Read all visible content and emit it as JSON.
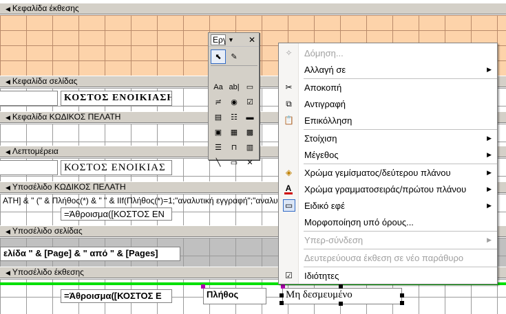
{
  "report": {
    "sections": {
      "report_header": "Κεφαλίδα έκθεσης",
      "page_header": "Κεφαλίδα σελίδας",
      "group_header": "Κεφαλίδα ΚΩΔΙΚΟΣ ΠΕΛΑΤΗ",
      "detail": "Λεπτομέρεια",
      "group_footer": "Υποσέλιδο ΚΩΔΙΚΟΣ ΠΕΛΑΤΗ",
      "page_footer": "Υποσέλιδο σελίδας",
      "report_footer": "Υποσέλιδο έκθεσης"
    },
    "controls": {
      "page_header_title": "ΚΟΣΤΟΣ ΕΝΟΙΚΙΑΣΗΣ",
      "detail_title": "ΚΟΣΤΟΣ ΕΝΟΙΚΙΑΣ",
      "group_footer_formula": "ΑΤΗ] & \" (\" & Πλήθος(*) & \" \" & IIf(Πλήθος(*)=1;\"αναλυτική εγγραφή\";\"αναλυτικές εγγραφές\")",
      "group_footer_sum": "=Άθροισμα([ΚΟΣΤΟΣ ΕΝ",
      "page_footer_text": "ελίδα \" & [Page] & \" από \" & [Pages]",
      "report_footer_sum": "=Άθροισμα([ΚΟΣΤΟΣ Ε",
      "report_footer_count": "Πλήθος",
      "report_footer_unbound": "Μη δεσμευμένο"
    }
  },
  "toolbox": {
    "title": "Εργ",
    "close": "✕",
    "dropdown": "▼",
    "tools": [
      {
        "name": "select-objects-icon",
        "glyph": "⬉"
      },
      {
        "name": "control-wizards-icon",
        "glyph": "✎"
      },
      {
        "name": "label-tool-icon",
        "glyph": "Aa"
      },
      {
        "name": "textbox-tool-icon",
        "glyph": "ab|"
      },
      {
        "name": "option-group-icon",
        "glyph": "▭"
      },
      {
        "name": "toggle-button-icon",
        "glyph": "≓"
      },
      {
        "name": "option-button-icon",
        "glyph": "◉"
      },
      {
        "name": "checkbox-tool-icon",
        "glyph": "☑"
      },
      {
        "name": "combo-box-icon",
        "glyph": "▤"
      },
      {
        "name": "list-box-icon",
        "glyph": "☷"
      },
      {
        "name": "command-button-icon",
        "glyph": "▬"
      },
      {
        "name": "image-tool-icon",
        "glyph": "▣"
      },
      {
        "name": "unbound-object-frame-icon",
        "glyph": "▦"
      },
      {
        "name": "bound-object-frame-icon",
        "glyph": "▩"
      },
      {
        "name": "page-break-icon",
        "glyph": "☰"
      },
      {
        "name": "tab-control-icon",
        "glyph": "⊓"
      },
      {
        "name": "subform-icon",
        "glyph": "▥"
      },
      {
        "name": "line-tool-icon",
        "glyph": "╲"
      },
      {
        "name": "rectangle-tool-icon",
        "glyph": "▭"
      },
      {
        "name": "more-controls-icon",
        "glyph": "✕"
      }
    ]
  },
  "context_menu": {
    "items": {
      "build": "Δόμηση...",
      "change_to": "Αλλαγή σε",
      "cut": "Αποκοπή",
      "copy": "Αντιγραφή",
      "paste": "Επικόλληση",
      "align": "Στοίχιση",
      "size": "Μέγεθος",
      "fill_color": "Χρώμα γεμίσματος/δεύτερου πλάνου",
      "font_color": "Χρώμα γραμματοσειράς/πρώτου πλάνου",
      "special_effect": "Ειδικό εφέ",
      "conditional_formatting": "Μορφοποίηση υπό όρους...",
      "hyperlink": "Υπερ-σύνδεση",
      "subreport_new_window": "Δευτερεύουσα έκθεση σε νέο παράθυρο",
      "properties": "Ιδιότητες"
    },
    "icons": {
      "build": "✧",
      "cut": "✂",
      "copy": "⧉",
      "paste": "📋",
      "fill_color": "◈",
      "font_color": "A",
      "special_effect": "▭",
      "properties": "☑"
    },
    "submenu_arrow": "▶"
  },
  "colors": {
    "report_header_fill": "#fdd3aa",
    "selection_line": "#00e000",
    "menu_highlight": "#316ac5"
  }
}
